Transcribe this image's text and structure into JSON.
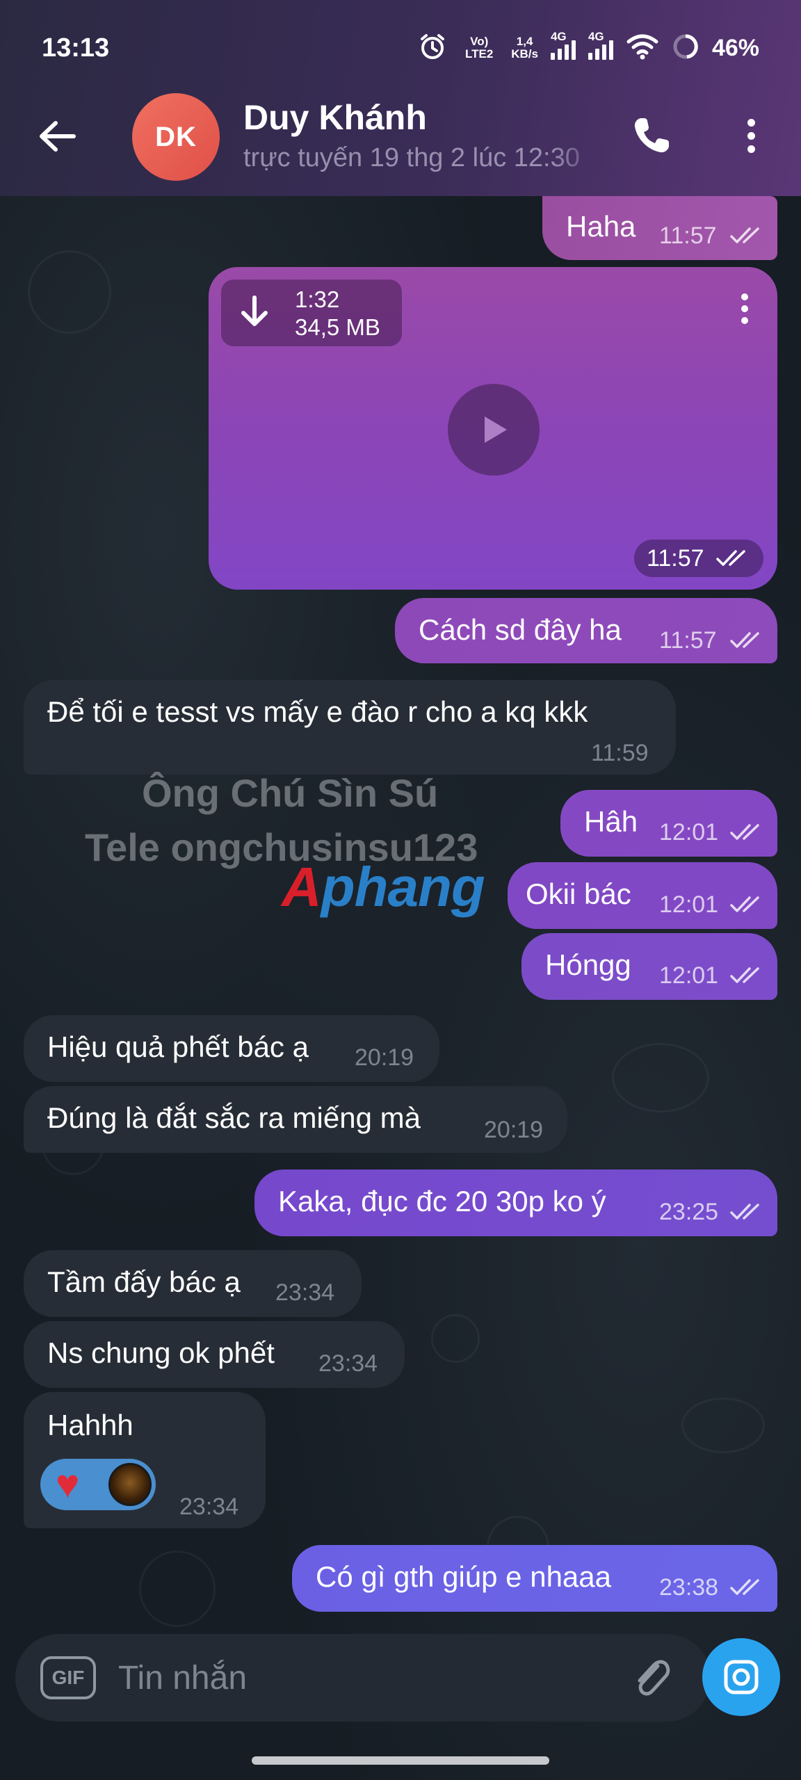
{
  "status_bar": {
    "time": "13:13",
    "volte": "Vo) LTE2",
    "speed_value": "1,4",
    "speed_unit": "KB/s",
    "net1": "4G",
    "net2": "4G",
    "battery": "46%"
  },
  "header": {
    "avatar_initials": "DK",
    "contact_name": "Duy Khánh",
    "contact_status": "trực tuyến 19 thg 2 lúc 12:30"
  },
  "messages": [
    {
      "text": "Haha",
      "time": "11:57",
      "direction": "out"
    },
    {
      "type": "video",
      "duration": "1:32",
      "size": "34,5 MB",
      "time": "11:57",
      "direction": "out"
    },
    {
      "text": "Cách sd đây ha",
      "time": "11:57",
      "direction": "out"
    },
    {
      "text": "Để tối e tesst vs mấy e đào r cho a kq kkk",
      "time": "11:59",
      "direction": "in"
    },
    {
      "text": "Hâh",
      "time": "12:01",
      "direction": "out"
    },
    {
      "text": "Okii bác",
      "time": "12:01",
      "direction": "out"
    },
    {
      "text": "Hóngg",
      "time": "12:01",
      "direction": "out"
    },
    {
      "text": "Hiệu quả phết bác ạ",
      "time": "20:19",
      "direction": "in"
    },
    {
      "text": "Đúng là đắt sắc ra miếng mà",
      "time": "20:19",
      "direction": "in"
    },
    {
      "text": "Kaka, đục đc 20 30p ko ý",
      "time": "23:25",
      "direction": "out"
    },
    {
      "text": "Tầm đấy bác ạ",
      "time": "23:34",
      "direction": "in"
    },
    {
      "text": "Ns chung ok phết",
      "time": "23:34",
      "direction": "in"
    },
    {
      "text": "Hahhh",
      "time": "23:34",
      "direction": "in",
      "reaction": "heart"
    },
    {
      "text": "Có gì gth giúp e nhaaa",
      "time": "23:38",
      "direction": "out"
    }
  ],
  "watermark": {
    "line1": "Ông Chú Sìn Sú",
    "line2": "Tele ongchusinsu123",
    "logo_a": "A",
    "logo_b": "phang"
  },
  "input": {
    "gif_label": "GIF",
    "placeholder": "Tin nhắn"
  },
  "colors": {
    "accent": "#2aa3ef",
    "incoming_bubble": "#272d36",
    "outgoing_top": "#a45aa6",
    "outgoing_bottom": "#6a5ee4"
  },
  "icons": {
    "back": "arrow-left-icon",
    "call": "phone-icon",
    "more": "more-vertical-icon",
    "download": "download-icon",
    "play": "play-icon",
    "attach": "paperclip-icon",
    "camera": "camera-icon",
    "read": "double-check-icon"
  }
}
